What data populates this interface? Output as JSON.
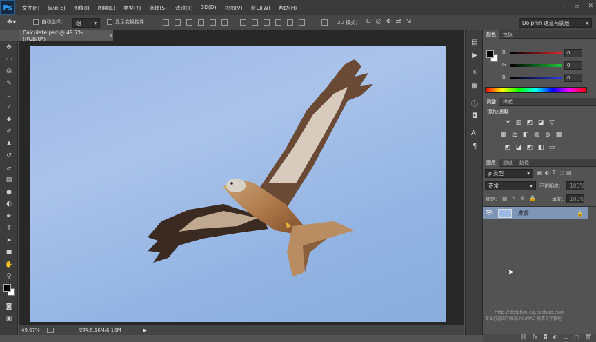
{
  "app": {
    "logo": "Ps"
  },
  "menu": [
    "文件(F)",
    "编辑(E)",
    "图像(I)",
    "图层(L)",
    "类型(Y)",
    "选择(S)",
    "滤镜(T)",
    "3D(D)",
    "视图(V)",
    "窗口(W)",
    "帮助(H)"
  ],
  "window_controls": [
    "–",
    "▭",
    "✕"
  ],
  "options_bar": {
    "auto_select_label": "自动选择：",
    "auto_select_value": "组",
    "transform_label": "显示变换控件",
    "mode_3d_label": "3D 模式：",
    "workspace": "Dolphin 通道与蒙版"
  },
  "document": {
    "tab_title": "Calculate.psd @ 49.7%(RGB/8*)",
    "tab_close": "×"
  },
  "status": {
    "zoom": "49.67%",
    "doc_size": "文档:6.16M/6.16M",
    "arrow": "▶"
  },
  "color_panel": {
    "tabs": [
      "颜色",
      "色板"
    ],
    "channels": [
      {
        "label": "R",
        "value": "0",
        "color": "#e0202a"
      },
      {
        "label": "G",
        "value": "0",
        "color": "#1fc23a"
      },
      {
        "label": "B",
        "value": "0",
        "color": "#2a3ae0"
      }
    ]
  },
  "adjust_panel": {
    "tabs": [
      "调整",
      "样式"
    ],
    "title": "添加调整"
  },
  "layers_panel": {
    "tabs": [
      "图层",
      "通道",
      "路径"
    ],
    "filter_label": "ρ 类型",
    "blend_mode": "正常",
    "opacity_label": "不透明度:",
    "opacity_value": "100%",
    "lock_label": "锁定:",
    "fill_label": "填充:",
    "fill_value": "100%",
    "layers": [
      {
        "name": "背景",
        "visible": true,
        "locked": true
      }
    ]
  },
  "watermark": {
    "line1": "http://dolphin-cg.taobao.com",
    "line2": "专业打造国内高端 PC/MAC 高清自学教程"
  },
  "colors": {
    "accent_layer": "#7e95b5",
    "sky": "#9db9e6"
  }
}
